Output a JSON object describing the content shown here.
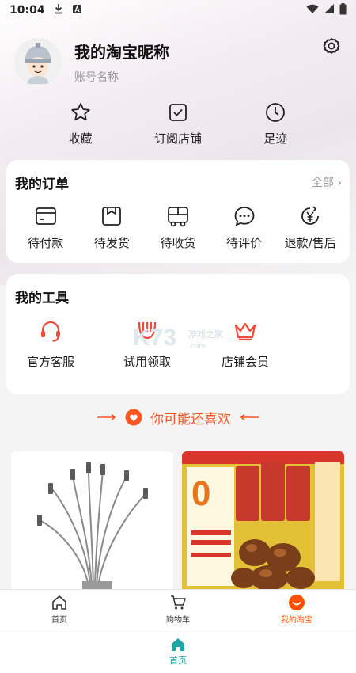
{
  "status_bar": {
    "time": "10:04"
  },
  "profile": {
    "nickname": "我的淘宝昵称",
    "account": "账号名称"
  },
  "quick": [
    {
      "label": "收藏",
      "icon": "star-icon"
    },
    {
      "label": "订阅店铺",
      "icon": "check-square-icon"
    },
    {
      "label": "足迹",
      "icon": "clock-icon"
    }
  ],
  "orders": {
    "title": "我的订单",
    "more": "全部",
    "items": [
      {
        "label": "待付款",
        "icon": "wallet-icon"
      },
      {
        "label": "待发货",
        "icon": "package-icon"
      },
      {
        "label": "待收货",
        "icon": "truck-icon"
      },
      {
        "label": "待评价",
        "icon": "chat-icon"
      },
      {
        "label": "退款/售后",
        "icon": "refund-icon"
      }
    ]
  },
  "tools": {
    "title": "我的工具",
    "items": [
      {
        "label": "官方客服",
        "icon": "headset-icon"
      },
      {
        "label": "试用领取",
        "icon": "gift-icon"
      },
      {
        "label": "店铺会员",
        "icon": "crown-icon"
      }
    ]
  },
  "recommend": {
    "title": "你可能还喜欢"
  },
  "tabbar": [
    {
      "label": "首页",
      "icon": "home-icon"
    },
    {
      "label": "购物车",
      "icon": "cart-icon"
    },
    {
      "label": "我的淘宝",
      "icon": "taobao-face-icon"
    }
  ],
  "bottom_nav": {
    "label": "首页"
  },
  "colors": {
    "accent": "#ff5000",
    "teal": "#1fa5a5",
    "tool_red": "#f04a3a"
  }
}
